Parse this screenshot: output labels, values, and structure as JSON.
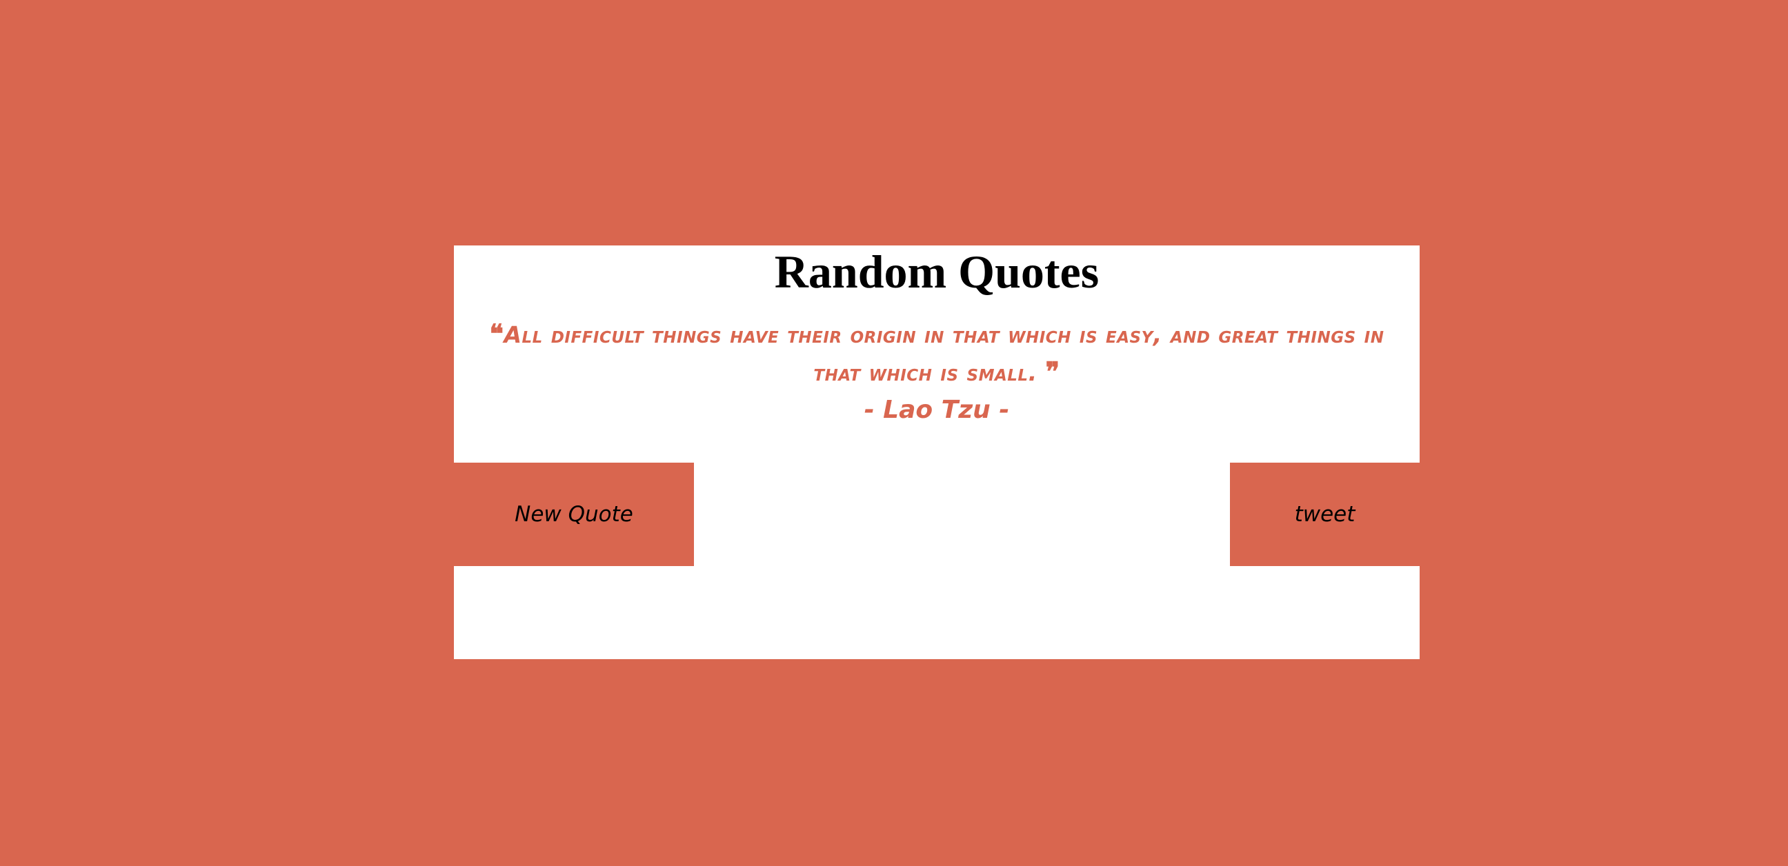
{
  "app": {
    "title": "Random Quotes"
  },
  "quote": {
    "open_mark": "❝",
    "text": "All difficult things have their origin in that which is easy, and great things in that which is small.",
    "close_mark": "❞",
    "author_line": "- Lao Tzu -"
  },
  "buttons": {
    "new_quote_label": "New Quote",
    "tweet_label": "tweet"
  },
  "colors": {
    "accent": "#d9664f",
    "card_background": "#ffffff",
    "title_text": "#000000"
  }
}
